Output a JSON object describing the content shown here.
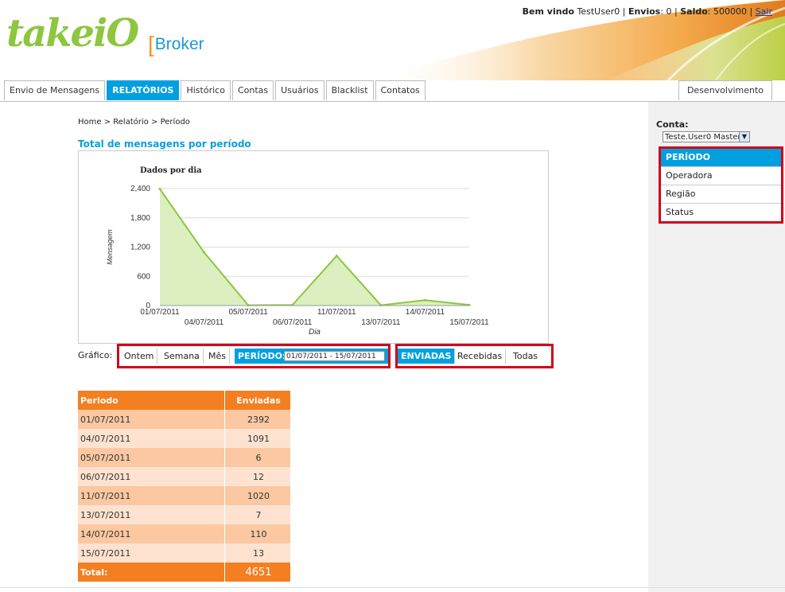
{
  "header": {
    "logo_text": "take",
    "logo_io": "iO",
    "bracket": "[",
    "product": "Broker",
    "welcome_label": "Bem vindo",
    "user": "TestUser0",
    "envios_label": "Envios",
    "envios_value": "0",
    "saldo_label": "Saldo",
    "saldo_value": "500000",
    "logout": "Sair"
  },
  "tabs": [
    "Envio de Mensagens",
    "RELATÓRIOS",
    "Histórico",
    "Contas",
    "Usuários",
    "Blacklist",
    "Contatos"
  ],
  "tab_right": "Desenvolvimento",
  "breadcrumb": "Home > Relatório > Período",
  "section_title": "Total de mensagens por período",
  "chart_data": {
    "type": "area",
    "title": "Dados por dia",
    "xlabel": "Dia",
    "ylabel": "Mensagem",
    "categories": [
      "01/07/2011",
      "04/07/2011",
      "05/07/2011",
      "06/07/2011",
      "11/07/2011",
      "13/07/2011",
      "14/07/2011",
      "15/07/2011"
    ],
    "values": [
      2392,
      1091,
      6,
      12,
      1020,
      7,
      110,
      13
    ],
    "yticks": [
      "0",
      "600",
      "1,200",
      "1,800",
      "2,400"
    ],
    "ylim": [
      0,
      2400
    ],
    "fill": "#dcefc0",
    "line": "#8dc63f",
    "grid": true
  },
  "controls": {
    "grafico_label": "Gráfico:",
    "ontem": "Ontem",
    "semana": "Semana",
    "mes": "Mês",
    "periodo_label": "PERÍODO:",
    "periodo_value": "01/07/2011 - 15/07/2011",
    "enviadas": "ENVIADAS",
    "recebidas": "Recebidas",
    "todas": "Todas"
  },
  "sidebar": {
    "conta_label": "Conta:",
    "conta_value": "Teste.User0 Master",
    "menu": [
      "PERÍODO",
      "Operadora",
      "Região",
      "Status"
    ]
  },
  "table": {
    "headers": [
      "Periodo",
      "Enviadas"
    ],
    "rows": [
      [
        "01/07/2011",
        "2392"
      ],
      [
        "04/07/2011",
        "1091"
      ],
      [
        "05/07/2011",
        "6"
      ],
      [
        "06/07/2011",
        "12"
      ],
      [
        "11/07/2011",
        "1020"
      ],
      [
        "13/07/2011",
        "7"
      ],
      [
        "14/07/2011",
        "110"
      ],
      [
        "15/07/2011",
        "13"
      ]
    ],
    "total_label": "Total:",
    "total_value": "4651"
  },
  "colors": {
    "accent_blue": "#00a0e0",
    "brand_green": "#8dc63f",
    "brand_orange": "#f47f20",
    "highlight_red": "#d3001b"
  }
}
